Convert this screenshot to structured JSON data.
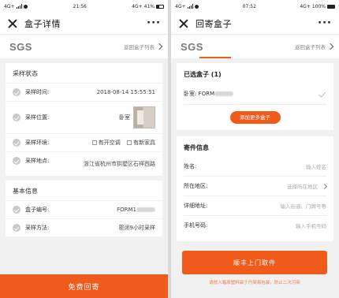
{
  "left": {
    "status": {
      "carrier": "4G+",
      "time": "21:56",
      "network": "4G+",
      "battery": "41%",
      "battery_pct": 41
    },
    "title": "盒子详情",
    "more": "···",
    "logo": "SGS",
    "back_link": "返回盒子列表",
    "sampling": {
      "section_title": "采样状态",
      "rows": [
        {
          "label": "采样时间:",
          "value": "2018-08-14 15:55:51"
        },
        {
          "label": "采样位置:",
          "value": "卧室"
        },
        {
          "label": "采样环境:",
          "opt1": "有开空调",
          "opt2": "有新家具"
        },
        {
          "label": "采样地点:",
          "value": "浙江省杭州市拱墅区石祥西路"
        }
      ]
    },
    "basic": {
      "section_title": "基本信息",
      "rows": [
        {
          "label": "盒子编号:",
          "value": "FORM1"
        },
        {
          "label": "采样方法:",
          "value": "密闭9小时采样"
        }
      ]
    },
    "bottom_button": "免费回寄"
  },
  "right": {
    "status": {
      "carrier": "4G+",
      "time": "07:52",
      "network": "4G+",
      "battery": "100%",
      "battery_pct": 100
    },
    "title": "回寄盒子",
    "more": "···",
    "logo": "SGS",
    "back_link": "返回盒子列表",
    "selected": {
      "title": "已选盒子 (1)",
      "box_label": "卧室: FORM",
      "add_button": "添加更多盒子"
    },
    "sender": {
      "title": "寄件信息",
      "fields": [
        {
          "label": "姓名:",
          "placeholder": "输入姓名"
        },
        {
          "label": "所在地区:",
          "placeholder": "选择所在地区"
        },
        {
          "label": "详细地址:",
          "placeholder": "输入街道、门牌号等"
        },
        {
          "label": "手机号码:",
          "placeholder": "输入手机号码"
        }
      ]
    },
    "ship_button": "顺丰上门取件",
    "note": "请放入箱原塑料袋于丹简易包装，防止二次污染"
  }
}
